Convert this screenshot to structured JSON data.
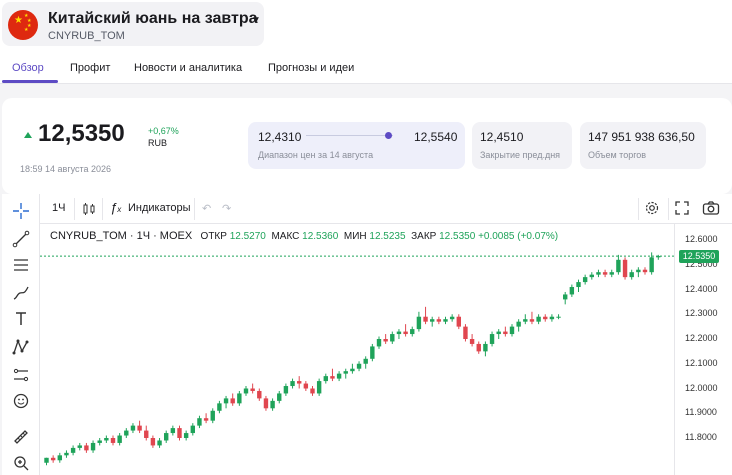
{
  "header": {
    "title": "Китайский юань на завтра",
    "ticker": "CNYRUB_TOM",
    "colors": {
      "flag_red": "#de2910",
      "flag_star": "#ffde00"
    }
  },
  "tabs": [
    {
      "label": "Обзор",
      "active": true
    },
    {
      "label": "Профит",
      "active": false
    },
    {
      "label": "Новости и аналитика",
      "active": false
    },
    {
      "label": "Прогнозы и идеи",
      "active": false
    }
  ],
  "quote": {
    "price": "12,5350",
    "change": "+0,67%",
    "currency": "RUB",
    "timestamp": "18:59 14 августа 2026",
    "range_low": "12,4310",
    "range_high": "12,5540",
    "range_label": "Диапазон цен за 14 августа",
    "range_position": 0.95,
    "prev_close": "12,4510",
    "prev_close_label": "Закрытие пред.дня",
    "volume": "147 951 938 636,50",
    "volume_label": "Объем торгов",
    "colors": {
      "up": "#1fa35a",
      "accent": "#5d4bc4"
    }
  },
  "toolbar": {
    "interval": "1Ч",
    "indicators": "Индикаторы",
    "icons": [
      "candles-icon",
      "function-icon",
      "undo-icon",
      "redo-icon",
      "settings-icon",
      "fullscreen-icon",
      "camera-icon"
    ]
  },
  "left_tools": [
    "crosshair-icon",
    "trendline-icon",
    "fib-lines-icon",
    "brush-icon",
    "text-icon",
    "pattern-icon",
    "measure-lines-icon",
    "emoji-icon",
    "ruler-icon",
    "zoom-icon"
  ],
  "legend": {
    "symbol": "CNYRUB_TOM · 1Ч · MOEX",
    "open_label": "ОТКР",
    "open": "12.5270",
    "high_label": "МАКС",
    "high": "12.5360",
    "low_label": "МИН",
    "low": "12.5235",
    "close_label": "ЗАКР",
    "close": "12.5350",
    "change": "+0.0085 (+0.07%)"
  },
  "chart_data": {
    "type": "candlestick",
    "ylim": [
      11.75,
      12.65
    ],
    "ticks": [
      "12.6000",
      "12.5000",
      "12.4000",
      "12.3000",
      "12.2000",
      "12.1000",
      "12.0000",
      "11.9000",
      "11.8000"
    ],
    "tick_values": [
      12.6,
      12.5,
      12.4,
      12.3,
      12.2,
      12.1,
      12.0,
      11.9,
      11.8
    ],
    "last_price": "12.5350",
    "last_value": 12.535,
    "colors": {
      "up": "#1fa35a",
      "down": "#e0464f"
    },
    "candles": [
      [
        11.7,
        11.72,
        11.69,
        11.72
      ],
      [
        11.72,
        11.73,
        11.7,
        11.71
      ],
      [
        11.71,
        11.74,
        11.7,
        11.73
      ],
      [
        11.73,
        11.75,
        11.72,
        11.74
      ],
      [
        11.74,
        11.77,
        11.73,
        11.76
      ],
      [
        11.76,
        11.78,
        11.75,
        11.77
      ],
      [
        11.77,
        11.78,
        11.74,
        11.75
      ],
      [
        11.75,
        11.79,
        11.74,
        11.78
      ],
      [
        11.78,
        11.8,
        11.77,
        11.79
      ],
      [
        11.79,
        11.81,
        11.78,
        11.8
      ],
      [
        11.8,
        11.81,
        11.77,
        11.78
      ],
      [
        11.78,
        11.82,
        11.77,
        11.81
      ],
      [
        11.81,
        11.84,
        11.8,
        11.83
      ],
      [
        11.83,
        11.86,
        11.82,
        11.85
      ],
      [
        11.85,
        11.87,
        11.82,
        11.83
      ],
      [
        11.83,
        11.85,
        11.79,
        11.8
      ],
      [
        11.8,
        11.81,
        11.76,
        11.77
      ],
      [
        11.77,
        11.8,
        11.76,
        11.79
      ],
      [
        11.79,
        11.83,
        11.78,
        11.82
      ],
      [
        11.82,
        11.85,
        11.81,
        11.84
      ],
      [
        11.84,
        11.85,
        11.79,
        11.8
      ],
      [
        11.8,
        11.83,
        11.79,
        11.82
      ],
      [
        11.82,
        11.86,
        11.81,
        11.85
      ],
      [
        11.85,
        11.89,
        11.84,
        11.88
      ],
      [
        11.88,
        11.9,
        11.86,
        11.87
      ],
      [
        11.87,
        11.92,
        11.86,
        11.91
      ],
      [
        11.91,
        11.95,
        11.9,
        11.94
      ],
      [
        11.94,
        11.97,
        11.92,
        11.96
      ],
      [
        11.96,
        11.98,
        11.93,
        11.94
      ],
      [
        11.94,
        11.99,
        11.93,
        11.98
      ],
      [
        11.98,
        12.01,
        11.97,
        12.0
      ],
      [
        12.0,
        12.02,
        11.98,
        11.99
      ],
      [
        11.99,
        12.0,
        11.95,
        11.96
      ],
      [
        11.96,
        11.97,
        11.91,
        11.92
      ],
      [
        11.92,
        11.96,
        11.91,
        11.95
      ],
      [
        11.95,
        11.99,
        11.94,
        11.98
      ],
      [
        11.98,
        12.02,
        11.97,
        12.01
      ],
      [
        12.01,
        12.04,
        12.0,
        12.03
      ],
      [
        12.03,
        12.05,
        12.0,
        12.02
      ],
      [
        12.02,
        12.03,
        11.99,
        12.0
      ],
      [
        12.0,
        12.01,
        11.97,
        11.98
      ],
      [
        11.98,
        12.04,
        11.97,
        12.03
      ],
      [
        12.03,
        12.06,
        12.02,
        12.05
      ],
      [
        12.05,
        12.08,
        12.03,
        12.04
      ],
      [
        12.04,
        12.07,
        12.03,
        12.06
      ],
      [
        12.06,
        12.08,
        12.04,
        12.07
      ],
      [
        12.07,
        12.1,
        12.06,
        12.08
      ],
      [
        12.08,
        12.11,
        12.07,
        12.1
      ],
      [
        12.1,
        12.13,
        12.08,
        12.12
      ],
      [
        12.12,
        12.18,
        12.11,
        12.17
      ],
      [
        12.17,
        12.21,
        12.16,
        12.2
      ],
      [
        12.2,
        12.22,
        12.18,
        12.19
      ],
      [
        12.19,
        12.23,
        12.18,
        12.22
      ],
      [
        12.22,
        12.24,
        12.2,
        12.23
      ],
      [
        12.23,
        12.26,
        12.21,
        12.22
      ],
      [
        12.22,
        12.25,
        12.21,
        12.24
      ],
      [
        12.24,
        12.31,
        12.23,
        12.29
      ],
      [
        12.29,
        12.33,
        12.26,
        12.27
      ],
      [
        12.27,
        12.29,
        12.25,
        12.28
      ],
      [
        12.28,
        12.29,
        12.26,
        12.27
      ],
      [
        12.27,
        12.29,
        12.26,
        12.28
      ],
      [
        12.28,
        12.3,
        12.27,
        12.29
      ],
      [
        12.29,
        12.3,
        12.24,
        12.25
      ],
      [
        12.25,
        12.26,
        12.19,
        12.2
      ],
      [
        12.2,
        12.22,
        12.17,
        12.18
      ],
      [
        12.18,
        12.19,
        12.14,
        12.15
      ],
      [
        12.15,
        12.19,
        12.13,
        12.18
      ],
      [
        12.18,
        12.23,
        12.17,
        12.22
      ],
      [
        12.22,
        12.24,
        12.2,
        12.23
      ],
      [
        12.23,
        12.25,
        12.21,
        12.22
      ],
      [
        12.22,
        12.26,
        12.21,
        12.25
      ],
      [
        12.25,
        12.28,
        12.23,
        12.27
      ],
      [
        12.27,
        12.3,
        12.26,
        12.28
      ],
      [
        12.28,
        12.31,
        12.26,
        12.27
      ],
      [
        12.27,
        12.3,
        12.26,
        12.29
      ],
      [
        12.29,
        12.3,
        12.27,
        12.28
      ],
      [
        12.28,
        12.3,
        12.27,
        12.29
      ],
      [
        12.29,
        12.3,
        12.28,
        12.29
      ],
      [
        12.36,
        12.39,
        12.34,
        12.38
      ],
      [
        12.38,
        12.42,
        12.37,
        12.41
      ],
      [
        12.41,
        12.44,
        12.39,
        12.43
      ],
      [
        12.43,
        12.46,
        12.42,
        12.45
      ],
      [
        12.45,
        12.47,
        12.44,
        12.46
      ],
      [
        12.46,
        12.48,
        12.45,
        12.47
      ],
      [
        12.47,
        12.48,
        12.45,
        12.46
      ],
      [
        12.46,
        12.48,
        12.45,
        12.47
      ],
      [
        12.47,
        12.54,
        12.46,
        12.52
      ],
      [
        12.52,
        12.53,
        12.44,
        12.45
      ],
      [
        12.45,
        12.48,
        12.44,
        12.47
      ],
      [
        12.47,
        12.49,
        12.45,
        12.48
      ],
      [
        12.48,
        12.49,
        12.46,
        12.47
      ],
      [
        12.47,
        12.55,
        12.46,
        12.53
      ],
      [
        12.53,
        12.54,
        12.52,
        12.535
      ]
    ]
  }
}
